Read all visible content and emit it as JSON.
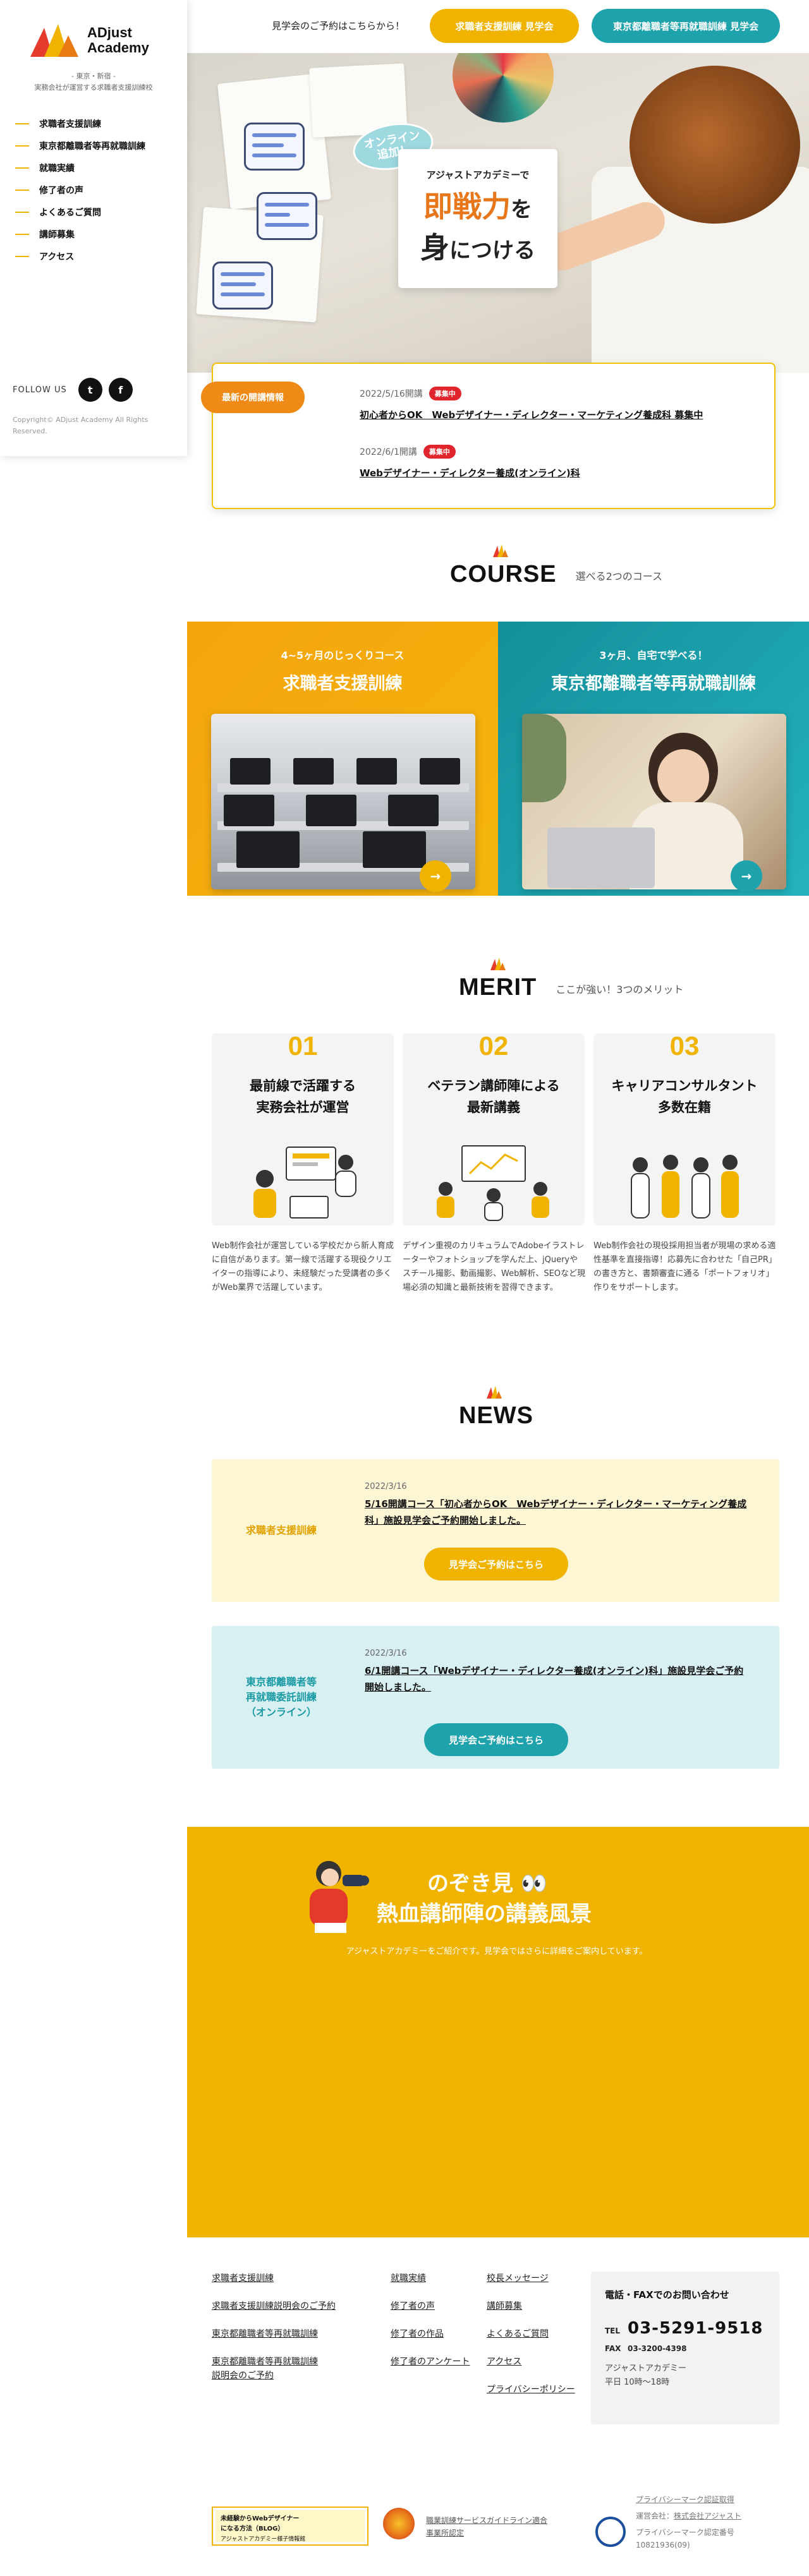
{
  "sidebar": {
    "logo_text_line1": "ADjust",
    "logo_text_line2": "Academy",
    "tagline_line1": "- 東京・新宿 -",
    "tagline_line2": "実務会社が運営する求職者支援訓練校",
    "nav": [
      {
        "label": "求職者支援訓練"
      },
      {
        "label": "東京都離職者等再就職訓練"
      },
      {
        "label": "就職実績"
      },
      {
        "label": "修了者の声"
      },
      {
        "label": "よくあるご質問"
      },
      {
        "label": "講師募集"
      },
      {
        "label": "アクセス"
      }
    ],
    "follow_label": "FOLLOW US",
    "sns": [
      {
        "icon": "twitter-icon",
        "glyph": "t"
      },
      {
        "icon": "facebook-icon",
        "glyph": "f"
      }
    ],
    "copyright": "Copyright© ADjust Academy All Rights Reserved."
  },
  "header": {
    "lead": "見学会のご予約はこちらから！",
    "btn_jobseeker": "求職者支援訓練 見学会",
    "btn_tokyo": "東京都離職者等再就職訓練 見学会"
  },
  "hero": {
    "bubble": "オンライン\n追加！",
    "sub": "アジャストアカデミーで",
    "big1": "即戦力",
    "big1_suffix": "を",
    "big2_prefix": "身",
    "big2": "につける"
  },
  "info": {
    "tag": "最新の開講情報",
    "items": [
      {
        "meta": "2022/5/16開講",
        "badge": "募集中",
        "title": "初心者からOK　Webデザイナー・ディレクター・マーケティング養成科 募集中"
      },
      {
        "meta": "2022/6/1開講",
        "badge": "募集中",
        "title": "Webデザイナー・ディレクター養成(オンライン)科"
      }
    ]
  },
  "course": {
    "heading_en": "COURSE",
    "heading_jp": "選べる2つのコース",
    "a": {
      "lead": "4~5ヶ月のじっくりコース",
      "name": "求職者支援訓練"
    },
    "b": {
      "lead": "3ヶ月、自宅で学べる！",
      "name": "東京都離職者等再就職訓練"
    }
  },
  "merit": {
    "heading_en": "MERIT",
    "heading_jp": "ここが強い！3つのメリット",
    "cards": [
      {
        "num": "01",
        "title1": "最前線で活躍する",
        "title2": "実務会社が運営",
        "text": "Web制作会社が運営している学校だから新人育成に自信があります。第一線で活躍する現役クリエイターの指導により、未経験だった受講者の多くがWeb業界で活躍しています。"
      },
      {
        "num": "02",
        "title1": "ベテラン講師陣による",
        "title2": "最新講義",
        "text": "デザイン重視のカリキュラムでAdobeイラストレーターやフォトショップを学んだ上、jQueryやスチール撮影、動画撮影、Web解析、SEOなど現場必須の知識と最新技術を習得できます。"
      },
      {
        "num": "03",
        "title1": "キャリアコンサルタント",
        "title2": "多数在籍",
        "text": "Web制作会社の現役採用担当者が現場の求める適性基準を直接指導！応募先に合わせた「自己PR」の書き方と、書類審査に通る「ポートフォリオ」作りをサポートします。"
      }
    ]
  },
  "news": {
    "heading_en": "NEWS",
    "items": [
      {
        "cat1": "求職者支援訓練",
        "cat2": "",
        "cat3": "",
        "date": "2022/3/16",
        "title": "5/16開講コース「初心者からOK　Webデザイナー・ディレクター・マーケティング養成科」施設見学会ご予約開始しました。",
        "btn": "見学会ご予約はこちら"
      },
      {
        "cat1": "東京都離職者等",
        "cat2": "再就職委託訓練",
        "cat3": "（オンライン）",
        "date": "2022/3/16",
        "title": "6/1開講コース「Webデザイナー・ディレクター養成(オンライン)科」施設見学会ご予約開始しました。",
        "btn": "見学会ご予約はこちら"
      }
    ]
  },
  "peek": {
    "title1": "のぞき見 👀",
    "title2": "熱血講師陣の講義風景",
    "sub": "アジャストアカデミーをご紹介です。見学会ではさらに詳細をご案内しています。"
  },
  "footer": {
    "col1": [
      "求職者支援訓練",
      "求職者支援訓練説明会のご予約",
      "東京都離職者等再就職訓練",
      "東京都離職者等再就職訓練説明会のご予約"
    ],
    "col2": [
      "就職実績",
      "修了者の声",
      "修了者の作品",
      "修了者のアンケート"
    ],
    "col3": [
      "校長メッセージ",
      "講師募集",
      "よくあるご質問",
      "アクセス",
      "プライバシーポリシー"
    ],
    "contact_title": "電話・FAXでのお問い合わせ",
    "tel_label": "TEL",
    "tel": "03-5291-9518",
    "fax_label": "FAX",
    "fax": "03-3200-4398",
    "org": "アジャストアカデミー",
    "hours": "平日 10時〜18時",
    "banner_line1": "未経験からWebデザイナー",
    "banner_line2": "になる方法（BLOG）",
    "banner_line3": "アジャストアカデミー様子情報館",
    "guideline_line1": "職業訓練サービスガイドライン適合",
    "guideline_line2": "事業所認定",
    "pmark_link": "プライバシーマーク認証取得",
    "pmark_org_label": "運営会社：",
    "pmark_org": "株式会社アジャスト",
    "pmark_no_label": "プライバシーマーク認定番号",
    "pmark_no": "10821936(09)"
  }
}
